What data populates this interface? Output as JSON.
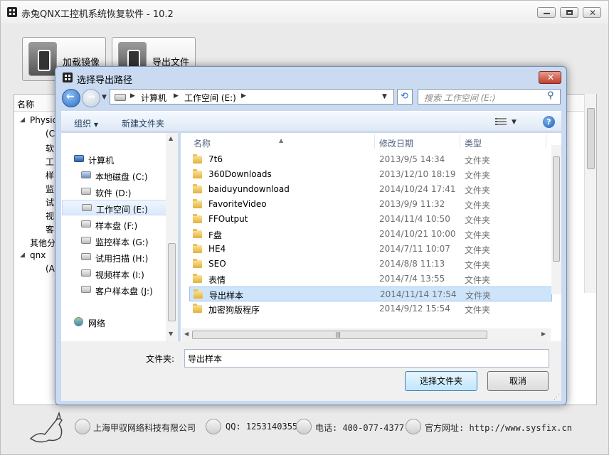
{
  "main_window": {
    "title": "赤兔QNX工控机系统恢复软件 - 10.2",
    "toolbar": {
      "load_label": "加载镜像",
      "export_label": "导出文件"
    },
    "tree": {
      "header": "名称",
      "rows": [
        "Physic",
        "(C:",
        "软",
        "工",
        "样",
        "监",
        "试",
        "视",
        "客",
        "其他分",
        "qnx",
        "(A:"
      ]
    }
  },
  "status_bar": {
    "company": "上海甲驭网络科技有限公司",
    "qq": "QQ: 1253140355",
    "phone": "电话: 400-077-4377",
    "website": "官方网址: http://www.sysfix.cn"
  },
  "dialog": {
    "title": "选择导出路径",
    "address": {
      "parts": [
        "计算机",
        "工作空间 (E:)"
      ]
    },
    "search_placeholder": "搜索 工作空间 (E:)",
    "commands": {
      "organize": "组织",
      "new_folder": "新建文件夹"
    },
    "nav": {
      "computer": "计算机",
      "drives": [
        {
          "label": "本地磁盘 (C:)"
        },
        {
          "label": "软件 (D:)"
        },
        {
          "label": "工作空间 (E:)"
        },
        {
          "label": "样本盘 (F:)"
        },
        {
          "label": "监控样本 (G:)"
        },
        {
          "label": "试用扫描 (H:)"
        },
        {
          "label": "视频样本 (I:)"
        },
        {
          "label": "客户样本盘 (J:)"
        }
      ],
      "network": "网络"
    },
    "columns": {
      "name": "名称",
      "date": "修改日期",
      "type": "类型"
    },
    "files": [
      {
        "name": "7t6",
        "date": "2013/9/5 14:34",
        "type": "文件夹"
      },
      {
        "name": "360Downloads",
        "date": "2013/12/10 18:19",
        "type": "文件夹"
      },
      {
        "name": "baiduyundownload",
        "date": "2014/10/24 17:41",
        "type": "文件夹"
      },
      {
        "name": "FavoriteVideo",
        "date": "2013/9/9 11:32",
        "type": "文件夹"
      },
      {
        "name": "FFOutput",
        "date": "2014/11/4 10:50",
        "type": "文件夹"
      },
      {
        "name": "F盘",
        "date": "2014/10/21 10:00",
        "type": "文件夹"
      },
      {
        "name": "HE4",
        "date": "2014/7/11 10:07",
        "type": "文件夹"
      },
      {
        "name": "SEO",
        "date": "2014/8/8 11:13",
        "type": "文件夹"
      },
      {
        "name": "表情",
        "date": "2014/7/4 13:55",
        "type": "文件夹"
      },
      {
        "name": "导出样本",
        "date": "2014/11/14 17:54",
        "type": "文件夹"
      },
      {
        "name": "加密狗版程序",
        "date": "2014/9/12 15:54",
        "type": "文件夹"
      }
    ],
    "folder_label": "文件夹:",
    "folder_value": "导出样本",
    "ok_label": "选择文件夹",
    "cancel_label": "取消"
  }
}
